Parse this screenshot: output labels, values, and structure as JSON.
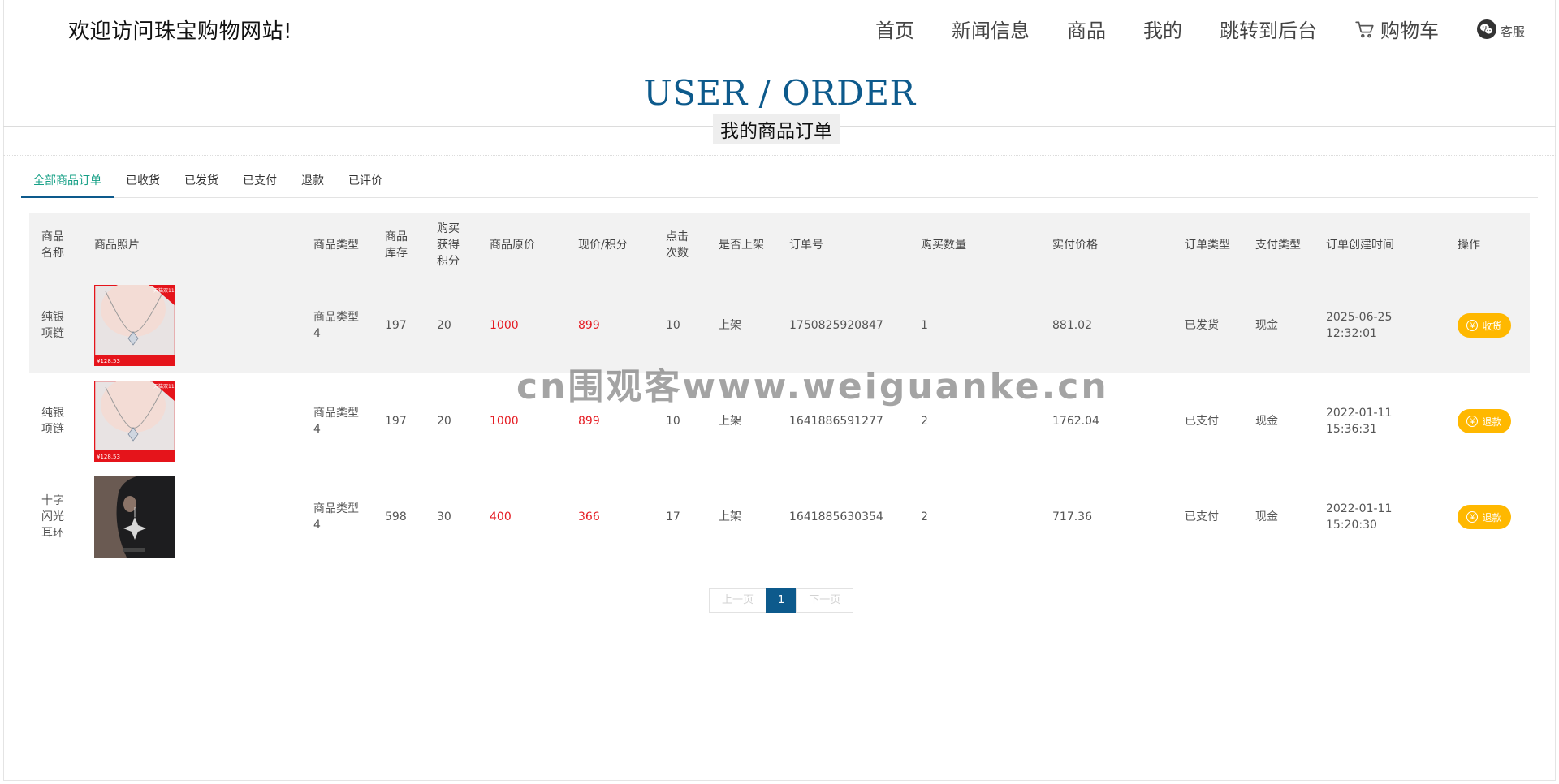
{
  "header": {
    "site_title": "欢迎访问珠宝购物网站!",
    "nav": [
      {
        "label": "首页"
      },
      {
        "label": "新闻信息"
      },
      {
        "label": "商品"
      },
      {
        "label": "我的"
      },
      {
        "label": "跳转到后台"
      },
      {
        "label": "购物车",
        "icon": "cart-icon"
      }
    ],
    "service_label": "客服",
    "service_icon": "wechat-icon"
  },
  "page": {
    "heading": "USER / ORDER",
    "subtitle": "我的商品订单"
  },
  "tabs": [
    {
      "label": "全部商品订单",
      "active": true
    },
    {
      "label": "已收货"
    },
    {
      "label": "已发货"
    },
    {
      "label": "已支付"
    },
    {
      "label": "退款"
    },
    {
      "label": "已评价"
    }
  ],
  "table": {
    "headers": [
      "商品名称",
      "商品照片",
      "商品类型",
      "商品库存",
      "购买获得积分",
      "商品原价",
      "现价/积分",
      "点击次数",
      "是否上架",
      "订单号",
      "购买数量",
      "实付价格",
      "订单类型",
      "支付类型",
      "订单创建时间",
      "操作"
    ],
    "rows": [
      {
        "name": "纯银项链",
        "image": "necklace",
        "image_text": {
          "badge": "天猫双11",
          "price": "¥128.53"
        },
        "type": "商品类型4",
        "stock": "197",
        "points": "20",
        "original_price": "1000",
        "current_price": "899",
        "clicks": "10",
        "on_shelf": "上架",
        "order_no": "1750825920847",
        "quantity": "1",
        "paid": "881.02",
        "order_type": "已发货",
        "pay_type": "现金",
        "created": "2025-06-25 12:32:01",
        "action": "收货"
      },
      {
        "name": "纯银项链",
        "image": "necklace",
        "image_text": {
          "badge": "天猫双11",
          "price": "¥128.53"
        },
        "type": "商品类型4",
        "stock": "197",
        "points": "20",
        "original_price": "1000",
        "current_price": "899",
        "clicks": "10",
        "on_shelf": "上架",
        "order_no": "1641886591277",
        "quantity": "2",
        "paid": "1762.04",
        "order_type": "已支付",
        "pay_type": "现金",
        "created": "2022-01-11 15:36:31",
        "action": "退款"
      },
      {
        "name": "十字闪光耳环",
        "image": "earring",
        "image_text": {
          "badge": "",
          "price": ""
        },
        "type": "商品类型4",
        "stock": "598",
        "points": "30",
        "original_price": "400",
        "current_price": "366",
        "clicks": "17",
        "on_shelf": "上架",
        "order_no": "1641885630354",
        "quantity": "2",
        "paid": "717.36",
        "order_type": "已支付",
        "pay_type": "现金",
        "created": "2022-01-11 15:20:30",
        "action": "退款"
      }
    ]
  },
  "pagination": {
    "prev": "上一页",
    "current": "1",
    "next": "下一页"
  },
  "watermark": "cn围观客www.weiguanke.cn",
  "colors": {
    "primary": "#0d5a8c",
    "accent_tab": "#16a086",
    "price_red": "#e51c23",
    "button": "#ffb800"
  }
}
